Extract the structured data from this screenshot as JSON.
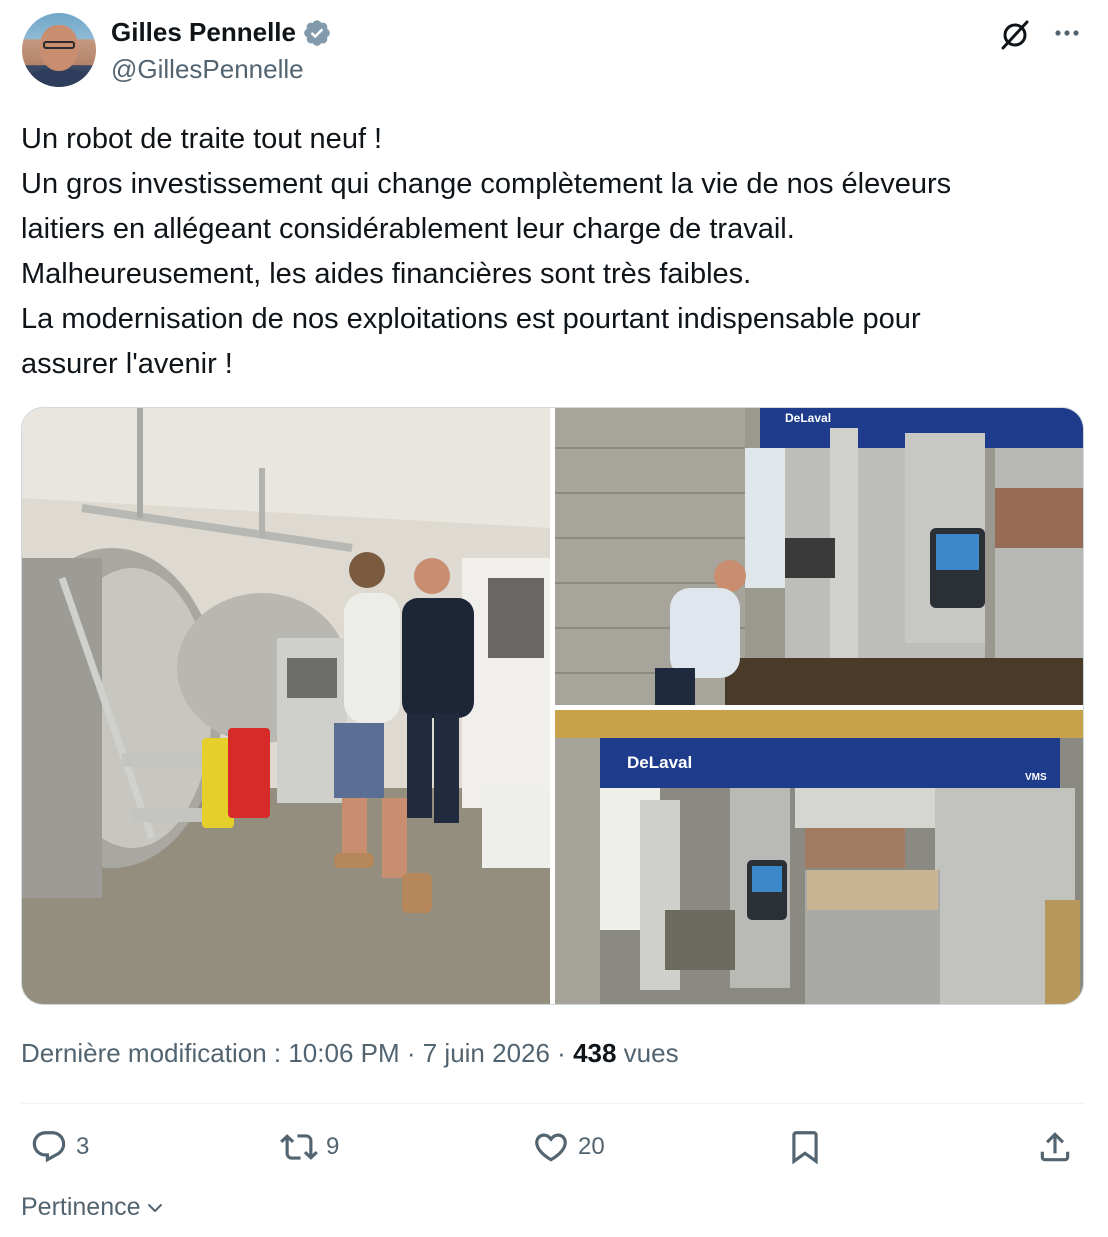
{
  "author": {
    "display_name": "Gilles Pennelle",
    "handle": "@GillesPennelle",
    "verified": true
  },
  "icons": {
    "verified": "verified-badge-icon",
    "grok": "grok-icon",
    "more": "more-options-icon",
    "reply": "reply-icon",
    "retweet": "retweet-icon",
    "like": "heart-icon",
    "bookmark": "bookmark-icon",
    "share": "share-icon",
    "sort": "chevron-down-icon"
  },
  "tweet": {
    "lines": [
      "Un robot de traite tout neuf !",
      "Un gros investissement qui change complètement la vie de nos éleveurs",
      "laitiers en allégeant considérablement leur charge de travail.",
      "Malheureusement, les aides financières sont très faibles.",
      "La modernisation de nos exploitations est pourtant indispensable pour",
      "assurer l'avenir !"
    ]
  },
  "media": {
    "photo_2_brand": "DeLaval",
    "photo_3_brand": "DeLaval",
    "photo_3_model": "VMS"
  },
  "meta": {
    "edited_label": "Dernière modification : 10:06 PM · 7 juin 2026 · ",
    "views_count": "438",
    "views_label": " vues"
  },
  "actions": {
    "replies": "3",
    "retweets": "9",
    "likes": "20"
  },
  "sort": {
    "label": "Pertinence"
  },
  "colors": {
    "text_primary": "#0f1419",
    "text_secondary": "#536471",
    "verified_blue": "#829aab",
    "divider": "#eff3f4",
    "delaval_blue": "#1e3a8a"
  }
}
